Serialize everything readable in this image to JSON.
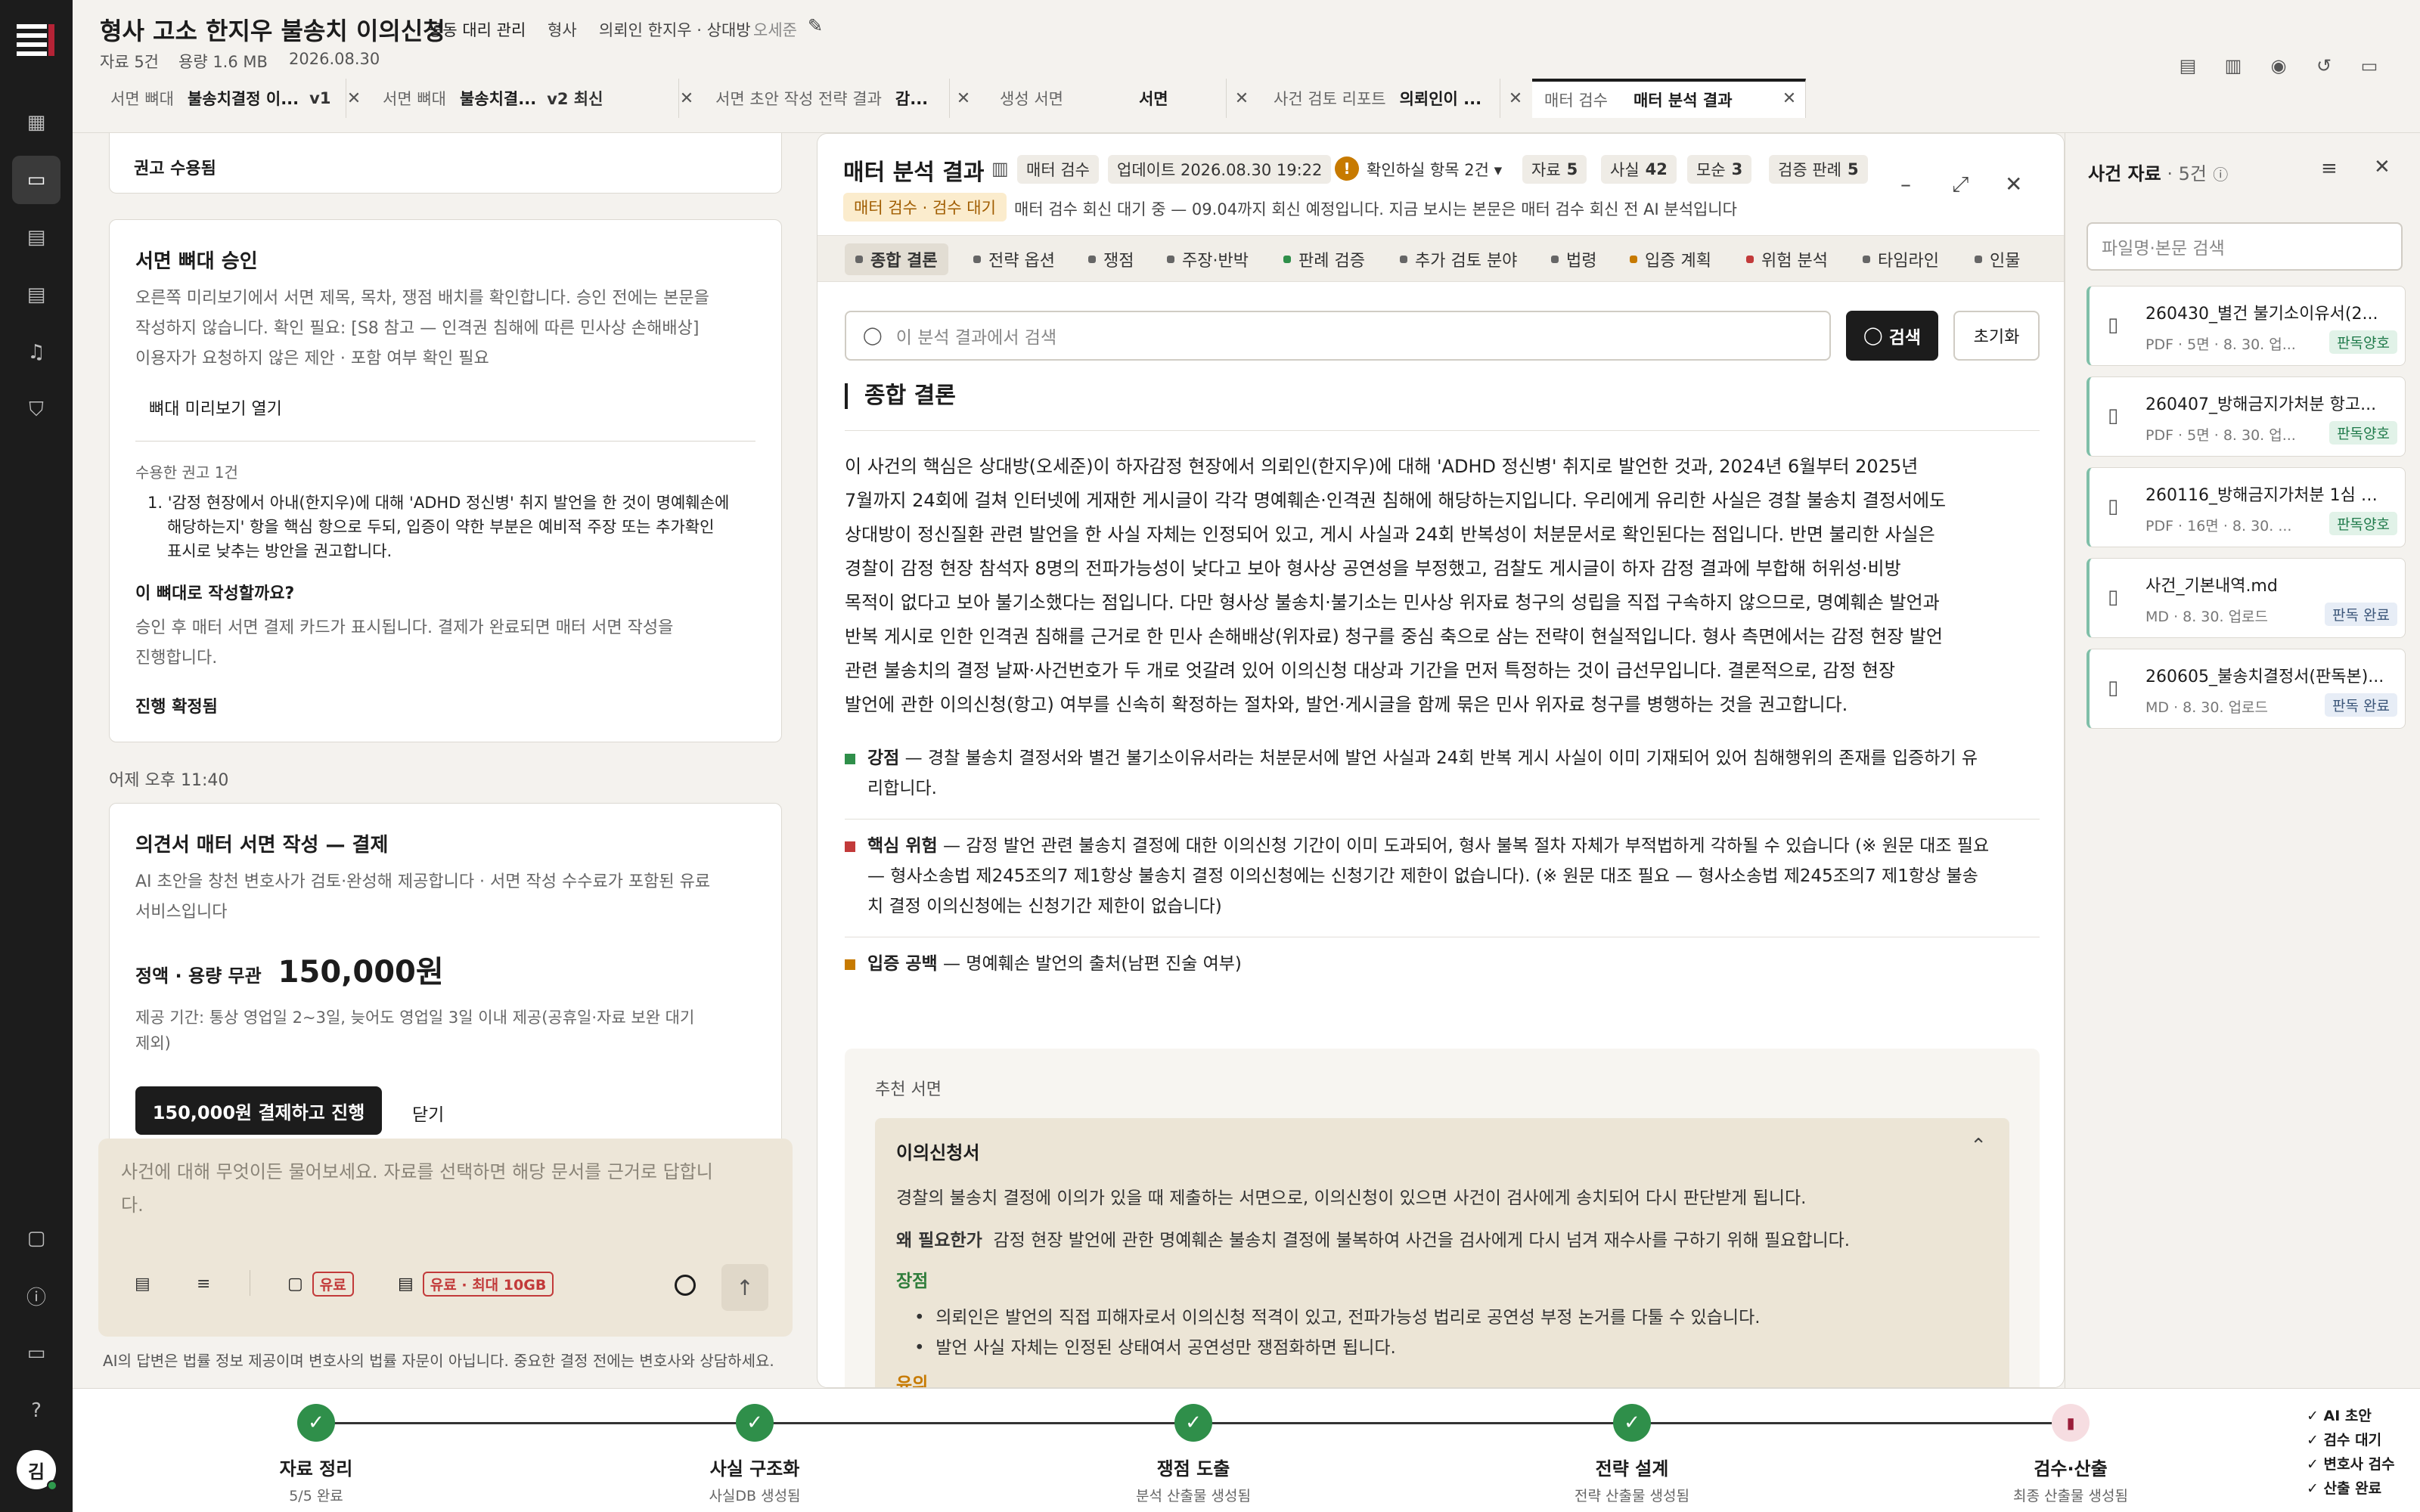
{
  "header": {
    "title": "형사 고소 한지우 불송치 이의신청",
    "agency": "공동 대리 관리",
    "type": "형사",
    "client": "의뢰인 한지우 · 상대방",
    "opponent": "오세준",
    "files": "자료 5건",
    "size": "용량 1.6 MB",
    "date": "2026.08.30"
  },
  "tabs": [
    {
      "label": "서면 뼈대",
      "value": "불송치결정 이...",
      "ver": "v1"
    },
    {
      "label": "서면 뼈대",
      "value": "불송치결...",
      "ver": "v2 최신"
    },
    {
      "label": "서면 초안 작성 전략 결과",
      "value": "감...",
      "ver": ""
    },
    {
      "label": "생성 서면",
      "value": "서면",
      "ver": ""
    },
    {
      "label": "사건 검토 리포트",
      "value": "의뢰인이 ...",
      "ver": ""
    },
    {
      "label": "매터 검수",
      "value": "매터 분석 결과",
      "ver": ""
    }
  ],
  "chat": {
    "accepted_title": "권고 수용됨",
    "skeleton_title": "서면 뼈대 승인",
    "skeleton_desc1": "오른쪽 미리보기에서 서면 제목, 목차, 쟁점 배치를 확인합니다. 승인 전에는 본문을",
    "skeleton_desc2": "작성하지 않습니다. 확인 필요: [S8 참고 — 인격권 침해에 따른 민사상 손해배상]",
    "skeleton_desc3": "이용자가 요청하지 않은 제안 · 포함 여부 확인 필요",
    "preview_btn": "뼈대 미리보기 열기",
    "accepted_count": "수용한 권고 1건",
    "rec_item1": "1. '감정 현장에서 아내(한지우)에 대해 'ADHD 정신병' 취지 발언을 한 것이 명예훼손에",
    "rec_item2": "해당하는지' 항을 핵심 항으로 두되, 입증이 약한 부분은 예비적 주장 또는 추가확인",
    "rec_item3": "표시로 낮추는 방안을 권고합니다.",
    "question": "이 뼈대로 작성할까요?",
    "after1": "승인 후 매터 서면 결제 카드가 표시됩니다. 결제가 완료되면 매터 서면 작성을",
    "after2": "진행합니다.",
    "confirmed": "진행 확정됨",
    "time": "어제 오후 11:40",
    "pay_title": "의견서 매터 서면 작성 — 결제",
    "pay_desc1": "AI 초안을 창천 변호사가 검토·완성해 제공합니다 · 서면 작성 수수료가 포함된 유료",
    "pay_desc2": "서비스입니다",
    "price_label": "정액 · 용량 무관",
    "price": "150,000원",
    "period1": "제공 기간: 통상 영업일 2~3일, 늦어도 영업일 3일 이내 제공(공휴일·자료 보완 대기",
    "period2": "제외)",
    "pay_btn": "150,000원 결제하고 진행",
    "close": "닫기",
    "composer1": "사건에 대해 무엇이든 물어보세요. 자료를 선택하면 해당 문서를 근거로 답합니",
    "composer2": "다.",
    "chip1": "유료",
    "chip2": "유료 · 최대 10GB",
    "disclaimer": "AI의 답변은 법률 정보 제공이며 변호사의 법률 자문이 아닙니다. 중요한 결정 전에는 변호사와 상담하세요."
  },
  "panel": {
    "title": "매터 분석 결과",
    "b1": "매터 검수",
    "b2": "업데이트 2026.08.30 19:22",
    "b3": "확인하실 항목 2건",
    "b4l": "자료",
    "b4v": "5",
    "b5l": "사실",
    "b5v": "42",
    "b6l": "모순",
    "b6v": "3",
    "b7l": "검증 판례",
    "b7v": "5",
    "await": "매터 검수 · 검수 대기",
    "await_text": "매터 검수 회신 대기 중 — 09.04까지 회신 예정입니다. 지금 보시는 본문은 매터 검수 회신 전 AI 분석입니다",
    "subtabs": [
      "종합 결론",
      "전략 옵션",
      "쟁점",
      "주장·반박",
      "판례 검증",
      "추가 검토 분야",
      "법령",
      "입증 계획",
      "위험 분석",
      "타임라인",
      "인물"
    ],
    "search_ph": "이 분석 결과에서 검색",
    "search_btn": "검색",
    "reset_btn": "초기화",
    "section": "종합 결론",
    "s1": "이 사건의 핵심은 상대방(오세준)이  하자감정 현장에서 의뢰인(한지우)에 대해 'ADHD 정신병' 취지로 발언한 것과, 2024년 6월부터 2025년",
    "s2": "7월까지 24회에 걸쳐 인터넷에 게재한 게시글이 각각 명예훼손·인격권 침해에 해당하는지입니다. 우리에게 유리한 사실은 경찰 불송치 결정서에도",
    "s3": "상대방이 정신질환 관련 발언을 한 사실 자체는 인정되어 있고, 게시 사실과 24회 반복성이 처분문서로 확인된다는 점입니다. 반면 불리한 사실은",
    "s4": "경찰이 감정 현장 참석자 8명의 전파가능성이 낮다고 보아 형사상 공연성을 부정했고, 검찰도 게시글이 하자 감정 결과에 부합해 허위성·비방",
    "s5": "목적이 없다고 보아 불기소했다는 점입니다. 다만 형사상 불송치·불기소는 민사상 위자료 청구의 성립을 직접 구속하지 않으므로, 명예훼손 발언과",
    "s6": "반복 게시로 인한 인격권 침해를 근거로 한 민사 손해배상(위자료) 청구를 중심 축으로 삼는 전략이 현실적입니다. 형사 측면에서는 감정 현장 발언",
    "s7": "관련 불송치의 결정 날짜·사건번호가 두 개로 엇갈려 있어 이의신청 대상과 기간을 먼저 특정하는 것이 급선무입니다. 결론적으로, 감정 현장",
    "s8": "발언에 관한 이의신청(항고) 여부를 신속히 확정하는 절차와, 발언·게시글을 함께 묶은 민사 위자료 청구를 병행하는 것을 권고합니다.",
    "p1k": "강점",
    "p1a": " — 경찰 불송치 결정서와 별건 불기소이유서라는 처분문서에 발언 사실과 24회 반복 게시 사실이 이미 기재되어 있어 침해행위의 존재를 입증하기 유",
    "p1b": "리합니다.",
    "p2k": "핵심 위험",
    "p2a": " — 감정 발언 관련 불송치 결정에 대한 이의신청 기간이 이미 도과되어, 형사 불복 절차 자체가 부적법하게 각하될 수 있습니다 (※ 원문 대조 필요",
    "p2b": "— 형사소송법 제245조의7 제1항상 불송치 결정 이의신청에는 신청기간 제한이 없습니다). (※ 원문 대조 필요 — 형사소송법 제245조의7 제1항상 불송",
    "p2c": "치 결정 이의신청에는 신청기간 제한이 없습니다)",
    "p3k": "입증 공백",
    "p3a": " — 명예훼손 발언의 출처(남편 진술 여부)",
    "rec_label": "추천 서면",
    "rec_name": "이의신청서",
    "rec_desc": "경찰의 불송치 결정에 이의가 있을 때 제출하는 서면으로, 이의신청이 있으면 사건이 검사에게 송치되어 다시 판단받게 됩니다.",
    "why_k": "왜 필요한가",
    "why": "감정 현장 발언에 관한 명예훼손 불송치 결정에 불복하여 사건을 검사에게 다시 넘겨 재수사를 구하기 위해 필요합니다.",
    "pros": "장점",
    "pro1": "의뢰인은 발언의 직접 피해자로서 이의신청 적격이 있고, 전파가능성 법리로 공연성 부정 논거를 다툴 수 있습니다.",
    "pro2": "발언 사실 자체는 인정된 상태여서 공연성만 쟁점화하면 됩니다.",
    "cons": "유의"
  },
  "side": {
    "title": "사건 자료",
    "count": " · 5건",
    "search_ph": "파일명·본문 검색",
    "docs": [
      {
        "name": "260430_별건 불기소이유서(2...",
        "meta": "PDF · 5면 · 8. 30. 업...",
        "badge": "판독양호"
      },
      {
        "name": "260407_방해금지가처분 항고...",
        "meta": "PDF · 5면 · 8. 30. 업...",
        "badge": "판독양호"
      },
      {
        "name": "260116_방해금지가처분 1심 기...",
        "meta": "PDF · 16면 · 8. 30. ...",
        "badge": "판독양호"
      },
      {
        "name": "사건_기본내역.md",
        "meta": "MD · 8. 30. 업로드",
        "badge": "판독 완료"
      },
      {
        "name": "260605_불송치결정서(판독본)...",
        "meta": "MD · 8. 30. 업로드",
        "badge": "판독 완료"
      }
    ]
  },
  "progress": [
    {
      "label": "자료 정리",
      "sub": "5/5 완료"
    },
    {
      "label": "사실 구조화",
      "sub": "사실DB 생성됨"
    },
    {
      "label": "쟁점 도출",
      "sub": "분석 산출물 생성됨"
    },
    {
      "label": "전략 설계",
      "sub": "전략 산출물 생성됨"
    },
    {
      "label": "검수·산출",
      "sub": "최종 산출물 생성됨"
    }
  ],
  "legend": [
    "✓ AI 초안",
    "✓ 검수 대기",
    "✓ 변호사 검수",
    "✓ 산출 완료"
  ],
  "user_initial": "김",
  "colors": {
    "accent": "#1c1c1c",
    "success": "#2f8f4a",
    "warning": "#c77a00",
    "danger": "#c23a3a"
  }
}
